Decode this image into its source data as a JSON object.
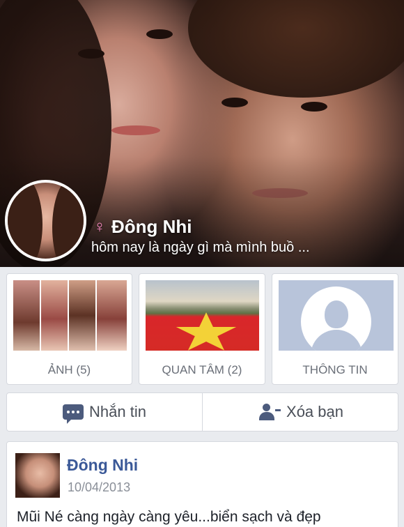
{
  "profile": {
    "name": "Đông Nhi",
    "gender_icon": "♀",
    "status": "hôm nay là ngày gì mà mình buồ ..."
  },
  "tiles": [
    {
      "label": "ẢNH (5)",
      "icon": "photos-thumbnail"
    },
    {
      "label": "QUAN TÂM (2)",
      "icon": "flag-thumbnail"
    },
    {
      "label": "THÔNG TIN",
      "icon": "person-silhouette-icon"
    }
  ],
  "actions": {
    "message_label": "Nhắn tin",
    "unfriend_label": "Xóa bạn"
  },
  "post": {
    "author": "Đông Nhi",
    "date": "10/04/2013",
    "text": "Mũi Né càng ngày càng yêu...biển sạch và đẹp"
  },
  "colors": {
    "link": "#3b5998",
    "icon": "#4c5b7d",
    "gender": "#ff8dc7"
  }
}
